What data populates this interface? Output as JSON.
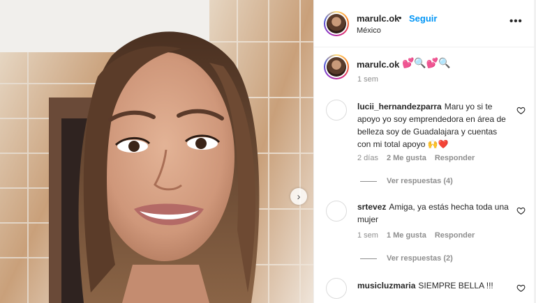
{
  "header": {
    "username": "marulc.ok",
    "separator": "•",
    "follow_label": "Seguir",
    "location": "México",
    "more_icon": "more-horizontal-icon",
    "more_glyph": "•••"
  },
  "caption": {
    "username": "marulc.ok",
    "text": "💕🔍💕🔍",
    "time": "1 sem"
  },
  "comments": [
    {
      "username": "lucii_hernandezparra",
      "text": "Maru yo si te apoyo yo soy emprendedora en área de belleza soy de Guadalajara y cuentas con mi total apoyo 🙌❤️",
      "time": "2 días",
      "likes": "2 Me gusta",
      "reply": "Responder",
      "view_replies": "Ver respuestas (4)"
    },
    {
      "username": "srtevez",
      "text": "Amiga, ya estás hecha toda una mujer",
      "time": "1 sem",
      "likes": "1 Me gusta",
      "reply": "Responder",
      "view_replies": "Ver respuestas (2)"
    },
    {
      "username": "musicluzmaria",
      "text": "SIEMPRE BELLA !!!"
    }
  ],
  "carousel": {
    "next_glyph": "›"
  },
  "colors": {
    "accent": "#0095f6",
    "secondary_text": "#8e8e8e",
    "border": "#efefef"
  }
}
